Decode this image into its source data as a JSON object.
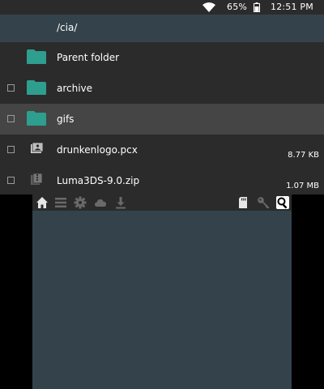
{
  "status": {
    "battery_percent": "65%",
    "time": "12:51 PM"
  },
  "browser": {
    "path": "/cia/",
    "items": [
      {
        "name": "Parent folder",
        "kind": "folder",
        "checkbox": false,
        "size": ""
      },
      {
        "name": "archive",
        "kind": "folder",
        "checkbox": true,
        "size": ""
      },
      {
        "name": "gifs",
        "kind": "folder",
        "checkbox": true,
        "size": "",
        "selected": true
      },
      {
        "name": "drunkenlogo.pcx",
        "kind": "image-file",
        "checkbox": true,
        "size": "8.77 KB"
      },
      {
        "name": "Luma3DS-9.0.zip",
        "kind": "archive-file",
        "checkbox": true,
        "size": "1.07 MB"
      }
    ]
  },
  "toolbar": {
    "left_icons": [
      "home-icon",
      "list-icon",
      "gear-icon",
      "cloud-icon",
      "download-icon"
    ],
    "right_icons": [
      "sd-card-icon",
      "key-icon",
      "search-icon"
    ],
    "active": "search-icon"
  },
  "colors": {
    "folder": "#2e9e8e",
    "path_bar": "#34434b",
    "list_bg": "#2b2b2b",
    "selected_row": "#454545",
    "bottom_bg": "#34434b"
  }
}
